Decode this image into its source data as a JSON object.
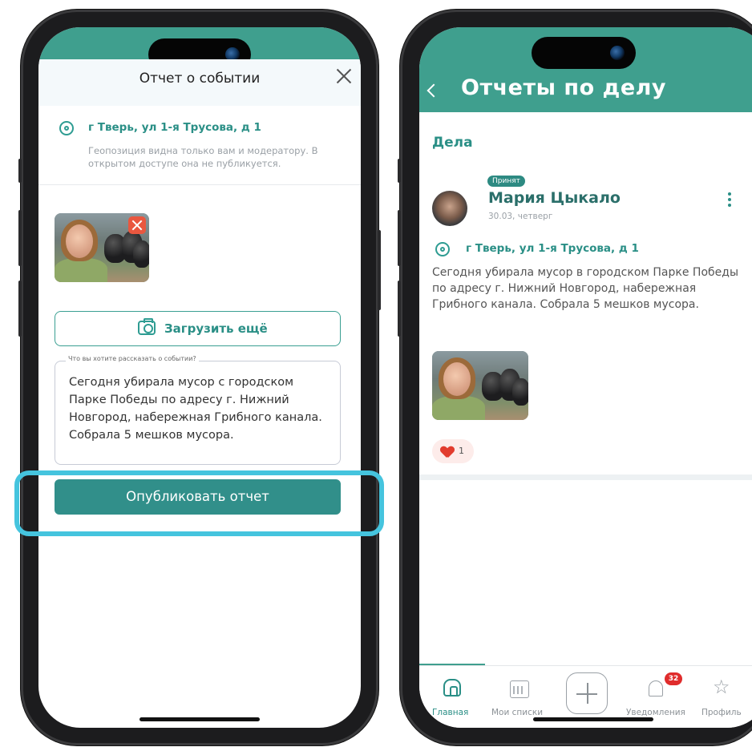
{
  "left_screen": {
    "title": "Отчет о событии",
    "address": "г Тверь, ул 1-я Трусова, д 1",
    "geo_note": "Геопозиция видна только вам и модератору. В открытом доступе она не публикуется.",
    "upload_more_label": "Загрузить ещё",
    "textarea_label": "Что вы хотите рассказать о событии?",
    "textarea_value": "Сегодня убирала мусор с городском Парке Победы по адресу г. Нижний Новгород, набережная Грибного канала. Собрала 5 мешков мусора.",
    "publish_label": "Опубликовать отчет"
  },
  "right_screen": {
    "title": "Отчеты по делу",
    "section_title": "Дела",
    "post": {
      "status_badge": "Принят",
      "author": "Мария Цыкало",
      "date": "30.03, четверг",
      "address": "г Тверь, ул 1-я Трусова, д 1",
      "text": "Сегодня убирала мусор в городском Парке Победы по адресу г. Нижний Новгород, набережная Грибного канала.  Собрала 5 мешков мусора.",
      "likes": "1"
    },
    "tabbar": {
      "home": "Главная",
      "lists": "Мои списки",
      "notifications": "Уведомления",
      "notifications_count": "32",
      "profile": "Профиль"
    }
  },
  "colors": {
    "brand_teal": "#3f9f8e",
    "button_teal": "#318f8a",
    "highlight": "#45c4de",
    "badge_red": "#e02c2c"
  }
}
